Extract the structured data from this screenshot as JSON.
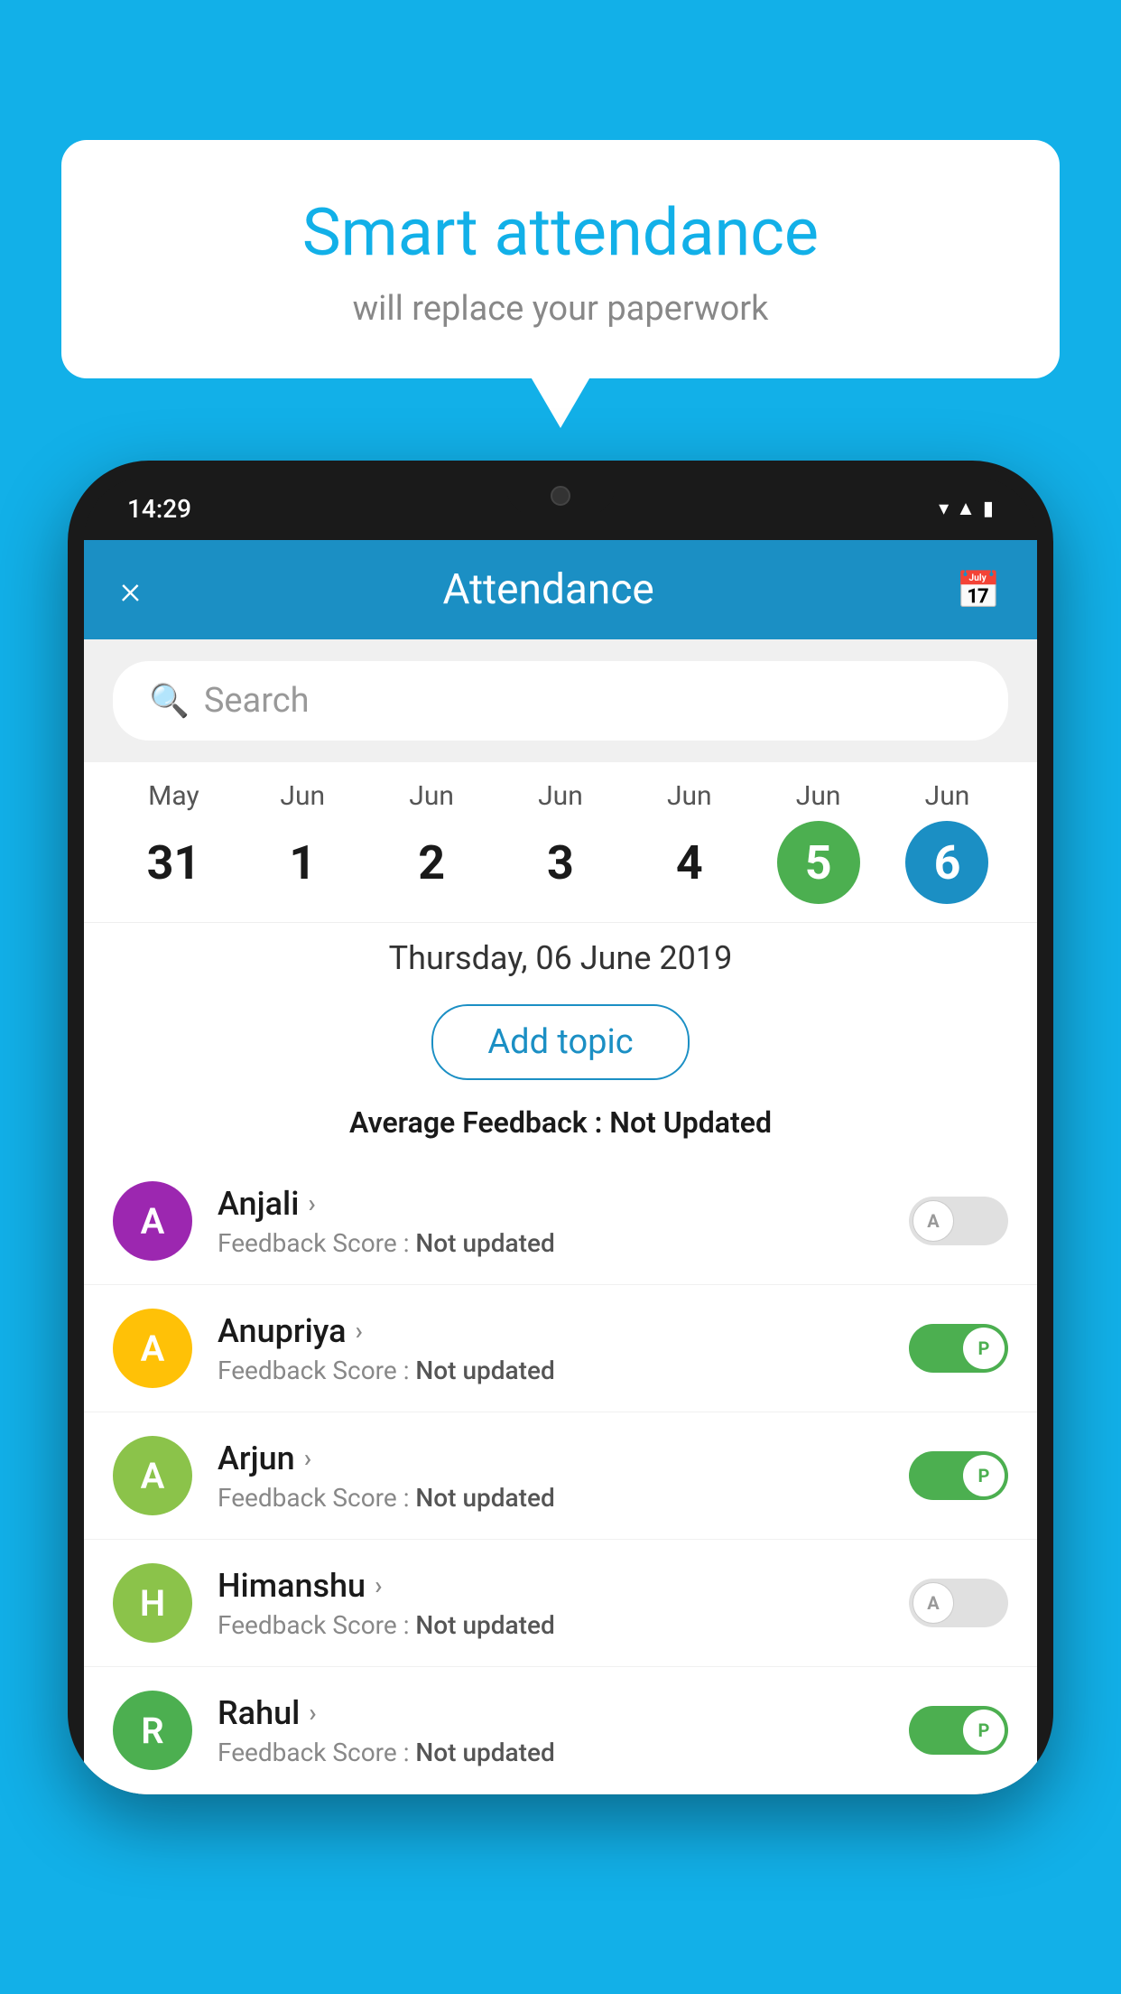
{
  "background_color": "#12B0E8",
  "bubble": {
    "title": "Smart attendance",
    "subtitle": "will replace your paperwork"
  },
  "phone": {
    "status_time": "14:29",
    "header": {
      "title": "Attendance",
      "close_label": "×",
      "calendar_icon": "📅"
    },
    "search": {
      "placeholder": "Search"
    },
    "dates": [
      {
        "month": "May",
        "day": "31",
        "state": "normal"
      },
      {
        "month": "Jun",
        "day": "1",
        "state": "normal"
      },
      {
        "month": "Jun",
        "day": "2",
        "state": "normal"
      },
      {
        "month": "Jun",
        "day": "3",
        "state": "normal"
      },
      {
        "month": "Jun",
        "day": "4",
        "state": "normal"
      },
      {
        "month": "Jun",
        "day": "5",
        "state": "today"
      },
      {
        "month": "Jun",
        "day": "6",
        "state": "selected"
      }
    ],
    "selected_date": "Thursday, 06 June 2019",
    "add_topic_label": "Add topic",
    "avg_feedback_label": "Average Feedback :",
    "avg_feedback_value": "Not Updated",
    "students": [
      {
        "name": "Anjali",
        "avatar_letter": "A",
        "avatar_color": "#9C27B0",
        "feedback_label": "Feedback Score :",
        "feedback_value": "Not updated",
        "attendance": "absent"
      },
      {
        "name": "Anupriya",
        "avatar_letter": "A",
        "avatar_color": "#FFC107",
        "feedback_label": "Feedback Score :",
        "feedback_value": "Not updated",
        "attendance": "present"
      },
      {
        "name": "Arjun",
        "avatar_letter": "A",
        "avatar_color": "#8BC34A",
        "feedback_label": "Feedback Score :",
        "feedback_value": "Not updated",
        "attendance": "present"
      },
      {
        "name": "Himanshu",
        "avatar_letter": "H",
        "avatar_color": "#8BC34A",
        "feedback_label": "Feedback Score :",
        "feedback_value": "Not updated",
        "attendance": "absent"
      },
      {
        "name": "Rahul",
        "avatar_letter": "R",
        "avatar_color": "#4CAF50",
        "feedback_label": "Feedback Score :",
        "feedback_value": "Not updated",
        "attendance": "present"
      }
    ]
  }
}
